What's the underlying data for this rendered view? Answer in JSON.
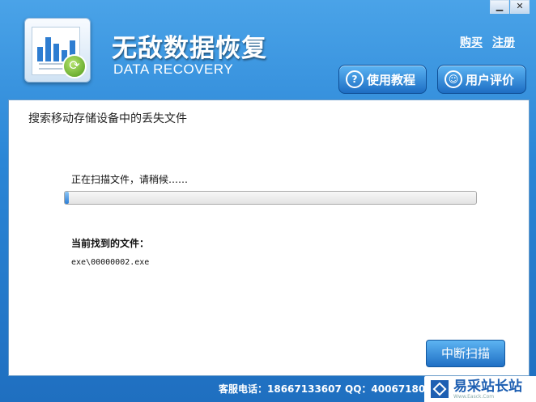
{
  "window": {
    "controls": {
      "minimize": "▁",
      "close": "✕"
    }
  },
  "header": {
    "title_cn": "无敌数据恢复",
    "title_en": "DATA RECOVERY",
    "links": {
      "buy": "购买",
      "register": "注册"
    },
    "buttons": {
      "tutorial": "使用教程",
      "review": "用户评价"
    }
  },
  "main": {
    "title": "搜索移动存储设备中的丢失文件",
    "status_text": "正在扫描文件，请稍候……",
    "progress": 0.01,
    "found_label": "当前找到的文件：",
    "found_file": "exe\\00000002.exe",
    "stop_button": "中断扫描"
  },
  "footer": {
    "contact": "客服电话：18667133607 QQ：40067180"
  },
  "watermark": {
    "text": "易采站长站",
    "sub": "Www.Easck.Com"
  },
  "colors": {
    "accent": "#2b86d6",
    "panel_border": "#6a9cc9"
  }
}
